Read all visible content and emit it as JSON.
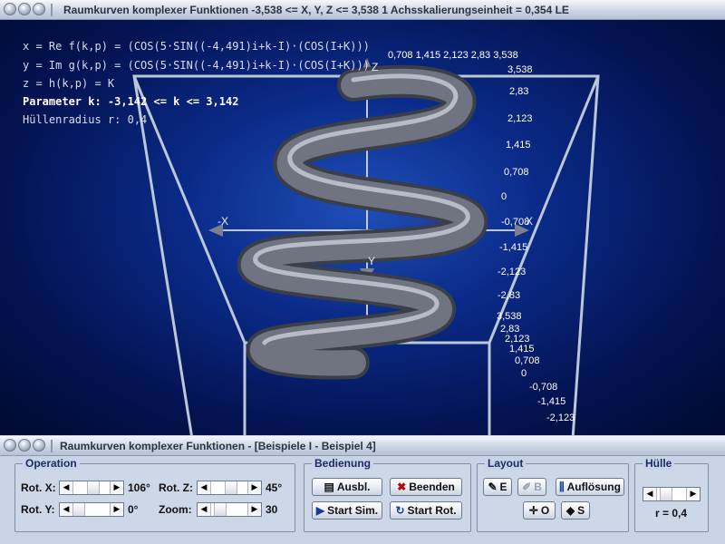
{
  "window": {
    "top_title": "Raumkurven komplexer Funktionen    -3,538 <= X, Y, Z <= 3,538    1 Achsskalierungseinheit = 0,354 LE",
    "bottom_title": "Raumkurven komplexer Funktionen - [Beispiele I - Beispiel 4]"
  },
  "info": {
    "line1": "x = Re f(k,p) = (COS(5·SIN((-4,491)i+k-I)·(COS(I+K)))",
    "line2": "y = Im g(k,p) = (COS(5·SIN((-4,491)i+k-I)·(COS(I+K)))",
    "line3": "z = h(k,p) = K",
    "param": "Parameter k: -3,142 <= k <= 3,142",
    "radius": "Hüllenradius r: 0,4"
  },
  "axes": {
    "x_minus": "-X",
    "x_plus": "X",
    "y": "Y",
    "z": "Z",
    "z_ticks": [
      "3,538",
      "2,83",
      "2,123",
      "1,415",
      "0,708",
      "0",
      "-0,708",
      "-1,415",
      "-2,123",
      "-2,83"
    ],
    "y_ticks": [
      "3,538",
      "2,83",
      "2,123",
      "1,415",
      "0,708",
      "0",
      "-0,708",
      "-1,415",
      "-2,123"
    ],
    "x_ticks_top": "0,708  1,415  2,123  2,83  3,538"
  },
  "operation": {
    "title": "Operation",
    "rot_x_label": "Rot. X:",
    "rot_x_value": "106°",
    "rot_y_label": "Rot. Y:",
    "rot_y_value": "0°",
    "rot_z_label": "Rot. Z:",
    "rot_z_value": "45°",
    "zoom_label": "Zoom:",
    "zoom_value": "30"
  },
  "bedienung": {
    "title": "Bedienung",
    "ausbl": "Ausbl.",
    "beenden": "Beenden",
    "start_sim": "Start Sim.",
    "start_rot": "Start Rot."
  },
  "layout": {
    "title": "Layout",
    "e": "E",
    "b": "B",
    "aufloesung": "Auflösung",
    "o": "O",
    "s": "S"
  },
  "huelle": {
    "title": "Hülle",
    "r_value": "r = 0,4"
  },
  "colors": {
    "background_center": "#1f4fb8",
    "background_edge": "#000a30",
    "tube": "#5a5f6b",
    "box_lines": "#b9c7d6",
    "panel": "#c8d4e6"
  }
}
